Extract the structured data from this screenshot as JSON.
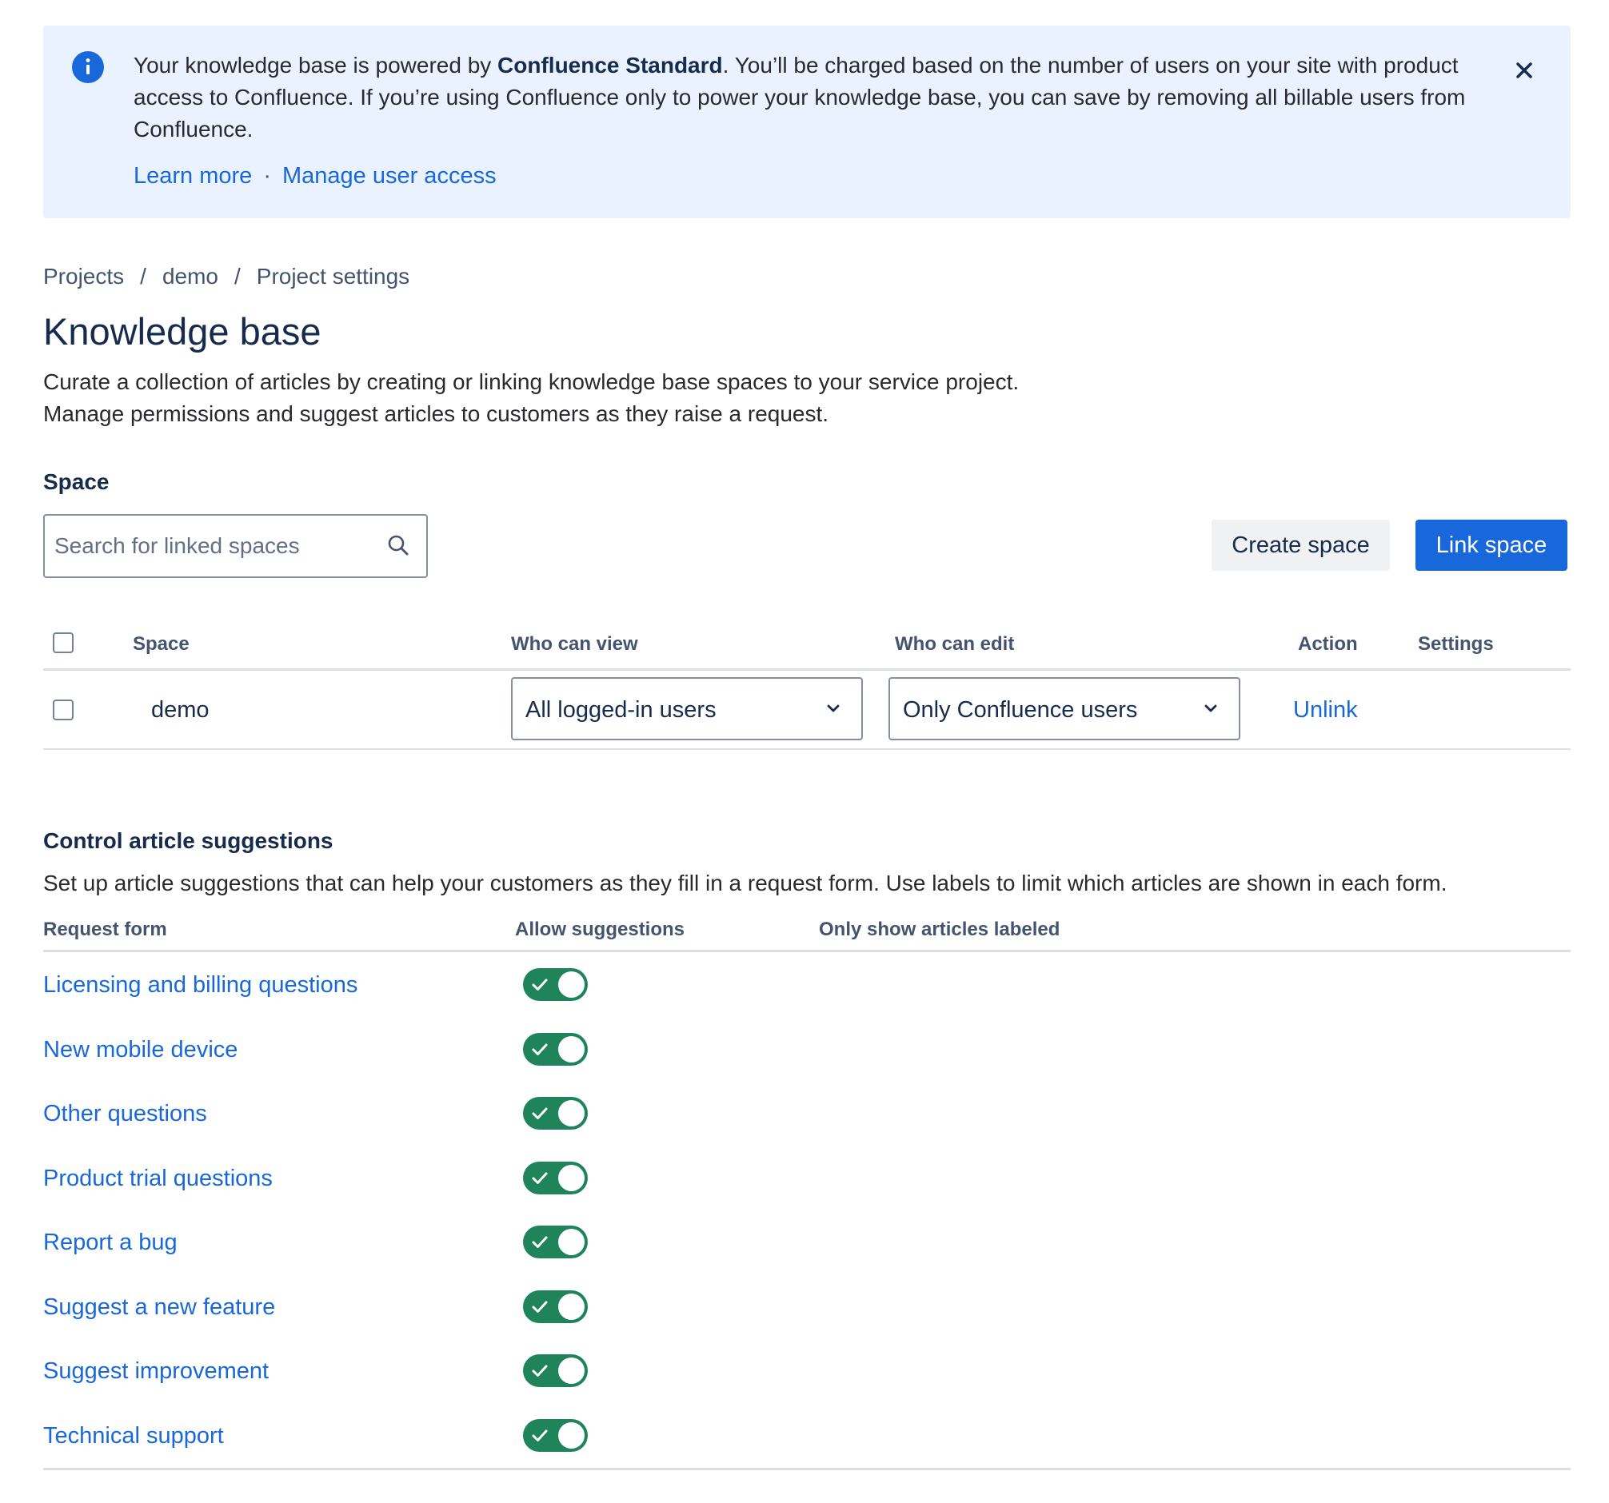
{
  "banner": {
    "text_before": "Your knowledge base is powered by ",
    "product": "Confluence Standard",
    "text_after": ". You’ll be charged based on the number of users on your site with product access to Confluence. If you’re using Confluence only to power your knowledge base, you can save by removing all billable users from Confluence.",
    "learn_more": "Learn more",
    "separator": "·",
    "manage_access": "Manage user access",
    "icon": "info-icon",
    "close_icon": "close-icon"
  },
  "breadcrumb": {
    "items": [
      "Projects",
      "demo",
      "Project settings"
    ],
    "separator": "/"
  },
  "page": {
    "title": "Knowledge base",
    "description_line1": "Curate a collection of articles by creating or linking knowledge base spaces to your service project.",
    "description_line2": "Manage permissions and suggest articles to customers as they raise a request."
  },
  "space_section": {
    "label": "Space",
    "search_placeholder": "Search for linked spaces",
    "create_button": "Create space",
    "link_button": "Link space"
  },
  "spaces_table": {
    "headers": {
      "space": "Space",
      "who_can_view": "Who can view",
      "who_can_edit": "Who can edit",
      "action": "Action",
      "settings": "Settings"
    },
    "rows": [
      {
        "name": "demo",
        "view": "All logged-in users",
        "edit": "Only Confluence users",
        "action": "Unlink",
        "selected": false
      }
    ]
  },
  "suggestions": {
    "title": "Control article suggestions",
    "description": "Set up article suggestions that can help your customers as they fill in a request form. Use labels to limit which articles are shown in each form.",
    "headers": {
      "request_form": "Request form",
      "allow": "Allow suggestions",
      "labels": "Only show articles labeled"
    },
    "rows": [
      {
        "form": "Licensing and billing questions",
        "allowed": true
      },
      {
        "form": "New mobile device",
        "allowed": true
      },
      {
        "form": "Other questions",
        "allowed": true
      },
      {
        "form": "Product trial questions",
        "allowed": true
      },
      {
        "form": "Report a bug",
        "allowed": true
      },
      {
        "form": "Suggest a new feature",
        "allowed": true
      },
      {
        "form": "Suggest improvement",
        "allowed": true
      },
      {
        "form": "Technical support",
        "allowed": true
      }
    ]
  },
  "colors": {
    "accent": "#1868db",
    "banner_bg": "#e9f2fe",
    "toggle_on": "#1f845a",
    "text": "#172b4d"
  }
}
